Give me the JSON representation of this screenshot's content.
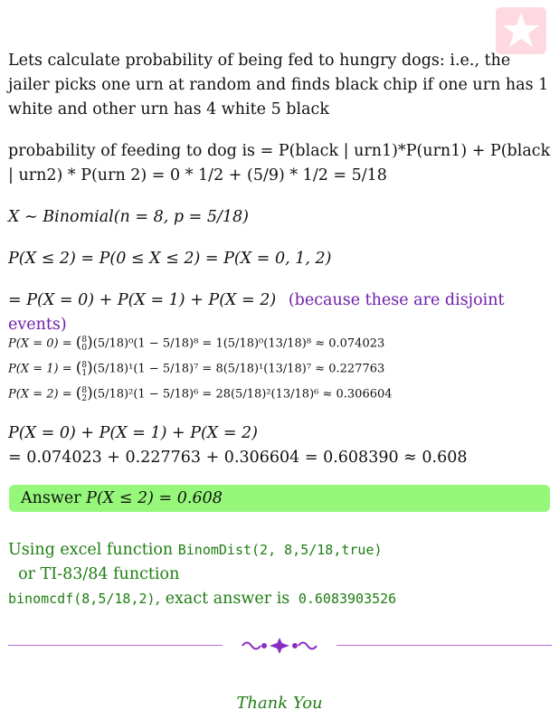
{
  "intro": "Lets calculate probability of being fed to hungry dogs: i.e., the jailer picks one urn at random and finds black chip if one urn has 1 white and other urn has 4 white 5 black",
  "feed": "probability of feeding to dog is = P(black | urn1)*P(urn1) + P(black | urn2) * P(urn 2) = 0 * 1/2 + (5/9) * 1/2 = 5/18",
  "dist": "X ∼ Binomial(n = 8, p = 5/18)",
  "cdf": "P(X ≤ 2) = P(0 ≤ X ≤ 2) = P(X = 0, 1, 2)",
  "sum_line": "= P(X = 0) + P(X = 1) + P(X = 2)",
  "disjoint_note": "(because these are disjoint events)",
  "terms": [
    {
      "lhs": "P(X = 0) =",
      "n": "8",
      "k": "0",
      "rest": "(5/18)⁰(1 − 5/18)⁸ = 1(5/18)⁰(13/18)⁸ ≈ 0.074023"
    },
    {
      "lhs": "P(X = 1) =",
      "n": "8",
      "k": "1",
      "rest": "(5/18)¹(1 − 5/18)⁷ = 8(5/18)¹(13/18)⁷ ≈ 0.227763"
    },
    {
      "lhs": "P(X = 2) =",
      "n": "8",
      "k": "2",
      "rest": "(5/18)²(1 − 5/18)⁶ = 28(5/18)²(13/18)⁶ ≈ 0.306604"
    }
  ],
  "total_line1": "P(X = 0) + P(X = 1) + P(X = 2)",
  "total_line2": "= 0.074023 + 0.227763 + 0.306604 = 0.608390 ≈ 0.608",
  "answer_label": "Answer",
  "answer_value": "P(X ≤ 2) = 0.608",
  "excel": {
    "prefix": "Using excel function ",
    "func1": "BinomDist(2, 8,5/18,true)",
    "mid": "  or TI-83/84 function",
    "func2": "binomcdf(8,5/18,2)",
    "suffix": ", exact answer is ",
    "exact": "0.6083903526"
  },
  "thanks": "Thank You",
  "colors": {
    "answer_bg": "#96f87a",
    "purple": "#6f1fa8",
    "green": "#1e7d12",
    "logo": "#ffd6df"
  }
}
